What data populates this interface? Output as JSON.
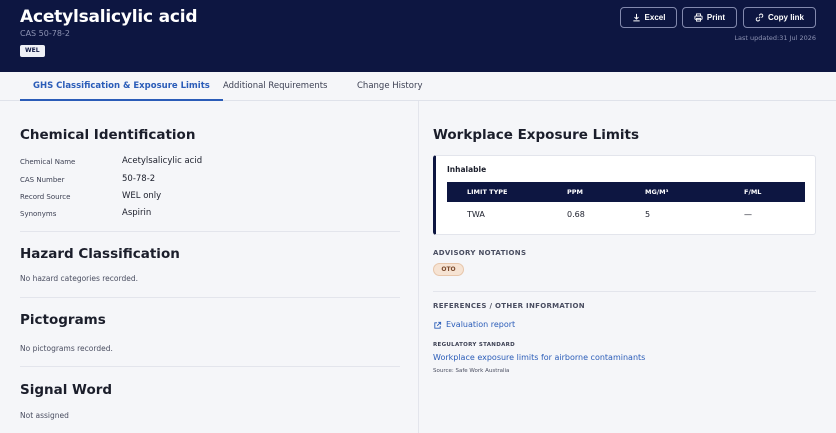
{
  "header": {
    "title": "Acetylsalicylic acid",
    "cas": "CAS 50-78-2",
    "badge": "WEL",
    "buttons": {
      "excel": "Excel",
      "print": "Print",
      "copy": "Copy link"
    },
    "last_updated": "Last updated:31 Jul 2026"
  },
  "tabs": [
    {
      "label": "GHS Classification & Exposure Limits",
      "active": true
    },
    {
      "label": "Additional Requirements",
      "active": false
    },
    {
      "label": "Change History",
      "active": false
    }
  ],
  "chemical_identification": {
    "heading": "Chemical Identification",
    "rows": [
      {
        "label": "Chemical Name",
        "value": "Acetylsalicylic acid"
      },
      {
        "label": "CAS Number",
        "value": "50-78-2"
      },
      {
        "label": "Record Source",
        "value": "WEL only"
      },
      {
        "label": "Synonyms",
        "value": "Aspirin"
      }
    ]
  },
  "hazard_classification": {
    "heading": "Hazard Classification",
    "text": "No hazard categories recorded."
  },
  "pictograms": {
    "heading": "Pictograms",
    "text": "No pictograms recorded."
  },
  "signal_word": {
    "heading": "Signal Word",
    "text": "Not assigned"
  },
  "exposure_limits": {
    "heading": "Workplace Exposure Limits",
    "card_title": "Inhalable",
    "columns": [
      "LIMIT TYPE",
      "PPM",
      "MG/M³",
      "F/ML"
    ],
    "rows": [
      [
        "TWA",
        "0.68",
        "5",
        "—"
      ]
    ]
  },
  "advisory": {
    "caption": "ADVISORY NOTATIONS",
    "badge": "OTO"
  },
  "references": {
    "caption": "REFERENCES / OTHER INFORMATION",
    "evaluation_link": "Evaluation report",
    "regulatory_caption": "REGULATORY STANDARD",
    "regulatory_link": "Workplace exposure limits for airborne contaminants",
    "source": "Source: Safe Work Australia"
  },
  "colors": {
    "header_bg": "#0d1641",
    "accent": "#2a5cb8",
    "page_bg": "#f5f6f9",
    "badge_oto_bg": "#f6e3d3"
  }
}
